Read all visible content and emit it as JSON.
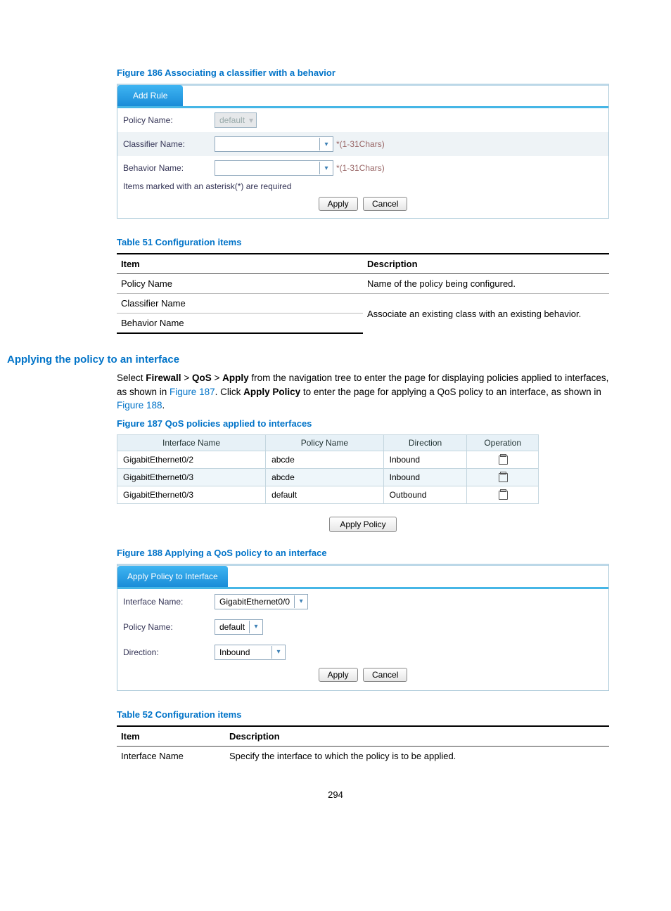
{
  "figure186": {
    "caption": "Figure 186 Associating a classifier with a behavior",
    "tab_title": "Add Rule",
    "rows": {
      "policy_name_label": "Policy Name:",
      "policy_name_value": "default",
      "classifier_name_label": "Classifier Name:",
      "classifier_hint": "*(1-31Chars)",
      "behavior_name_label": "Behavior Name:",
      "behavior_hint": "*(1-31Chars)"
    },
    "required_note": "Items marked with an asterisk(*) are required",
    "apply_btn": "Apply",
    "cancel_btn": "Cancel"
  },
  "table51": {
    "caption": "Table 51 Configuration items",
    "head_item": "Item",
    "head_desc": "Description",
    "rows": [
      {
        "item": "Policy Name",
        "desc": "Name of the policy being configured."
      },
      {
        "item": "Classifier Name",
        "desc": ""
      },
      {
        "item": "Behavior Name",
        "desc": ""
      }
    ],
    "merged_desc": "Associate an existing class with an existing behavior."
  },
  "applying_heading": "Applying the policy to an interface",
  "applying_para": {
    "pre": "Select ",
    "nav1": "Firewall",
    "sep": " > ",
    "nav2": "QoS",
    "nav3": "Apply",
    "mid1": " from the navigation tree to enter the page for displaying policies applied to interfaces, as shown in ",
    "fig187_link": "Figure 187",
    "mid2": ". Click ",
    "apply_policy": "Apply Policy",
    "mid3": " to enter the page for applying a QoS policy to an interface, as shown in ",
    "fig188_link": "Figure 188",
    "end": "."
  },
  "figure187": {
    "caption": "Figure 187 QoS policies applied to interfaces",
    "headers": [
      "Interface Name",
      "Policy Name",
      "Direction",
      "Operation"
    ],
    "rows": [
      {
        "iface": "GigabitEthernet0/2",
        "policy": "abcde",
        "dir": "Inbound"
      },
      {
        "iface": "GigabitEthernet0/3",
        "policy": "abcde",
        "dir": "Inbound"
      },
      {
        "iface": "GigabitEthernet0/3",
        "policy": "default",
        "dir": "Outbound"
      }
    ],
    "apply_btn": "Apply Policy"
  },
  "figure188": {
    "caption": "Figure 188 Applying a QoS policy to an interface",
    "tab_title": "Apply Policy to Interface",
    "rows": {
      "iface_label": "Interface Name:",
      "iface_value": "GigabitEthernet0/0",
      "policy_label": "Policy Name:",
      "policy_value": "default",
      "direction_label": "Direction:",
      "direction_value": "Inbound"
    },
    "apply_btn": "Apply",
    "cancel_btn": "Cancel"
  },
  "table52": {
    "caption": "Table 52 Configuration items",
    "head_item": "Item",
    "head_desc": "Description",
    "rows": [
      {
        "item": "Interface Name",
        "desc": "Specify the interface to which the policy is to be applied."
      }
    ]
  },
  "page_number": "294"
}
